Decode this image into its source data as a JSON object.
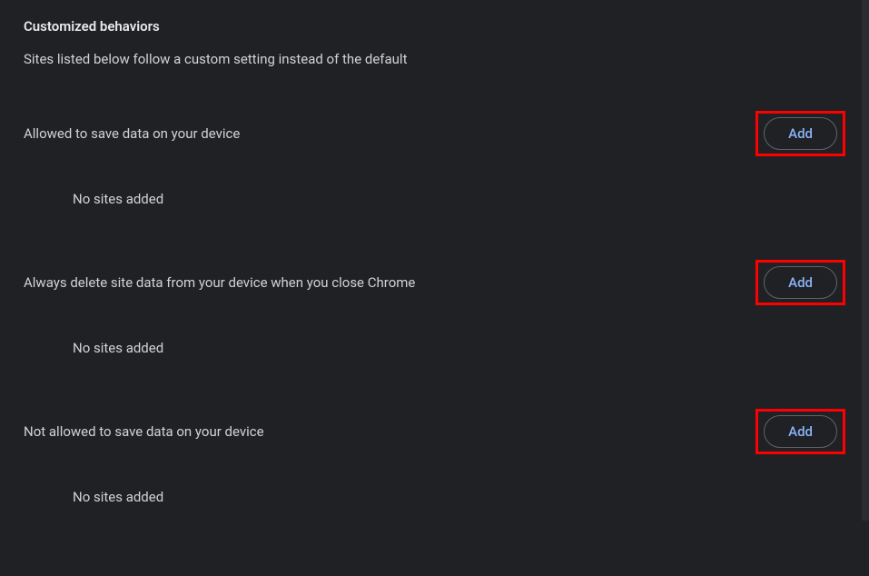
{
  "header": {
    "title": "Customized behaviors",
    "subtitle": "Sites listed below follow a custom setting instead of the default"
  },
  "sections": [
    {
      "label": "Allowed to save data on your device",
      "button_label": "Add",
      "empty_text": "No sites added"
    },
    {
      "label": "Always delete site data from your device when you close Chrome",
      "button_label": "Add",
      "empty_text": "No sites added"
    },
    {
      "label": "Not allowed to save data on your device",
      "button_label": "Add",
      "empty_text": "No sites added"
    }
  ]
}
